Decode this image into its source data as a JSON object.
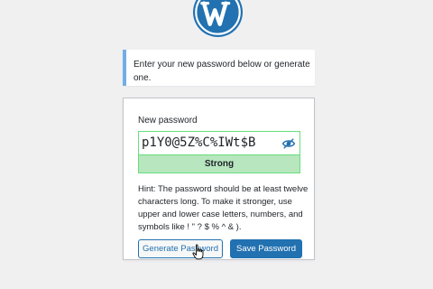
{
  "logo": {
    "icon": "wordpress-logo-icon",
    "color": "#2271b1"
  },
  "notice": {
    "text": "Enter your new password below or generate one.",
    "accent_color": "#72aee6"
  },
  "form": {
    "new_password_label": "New password",
    "password_value": "p1Y0@5Z%C%IWt$B",
    "toggle_icon": "eye-slash-icon",
    "strength_label": "Strong",
    "strength_color": "#b8e6bf",
    "hint": "Hint: The password should be at least twelve characters long. To make it stronger, use upper and lower case letters, numbers, and symbols like ! \" ? $ % ^ & ).",
    "generate_label": "Generate Password",
    "save_label": "Save Password",
    "primary_color": "#2271b1"
  },
  "cursor": {
    "icon": "hand-pointer-icon"
  }
}
